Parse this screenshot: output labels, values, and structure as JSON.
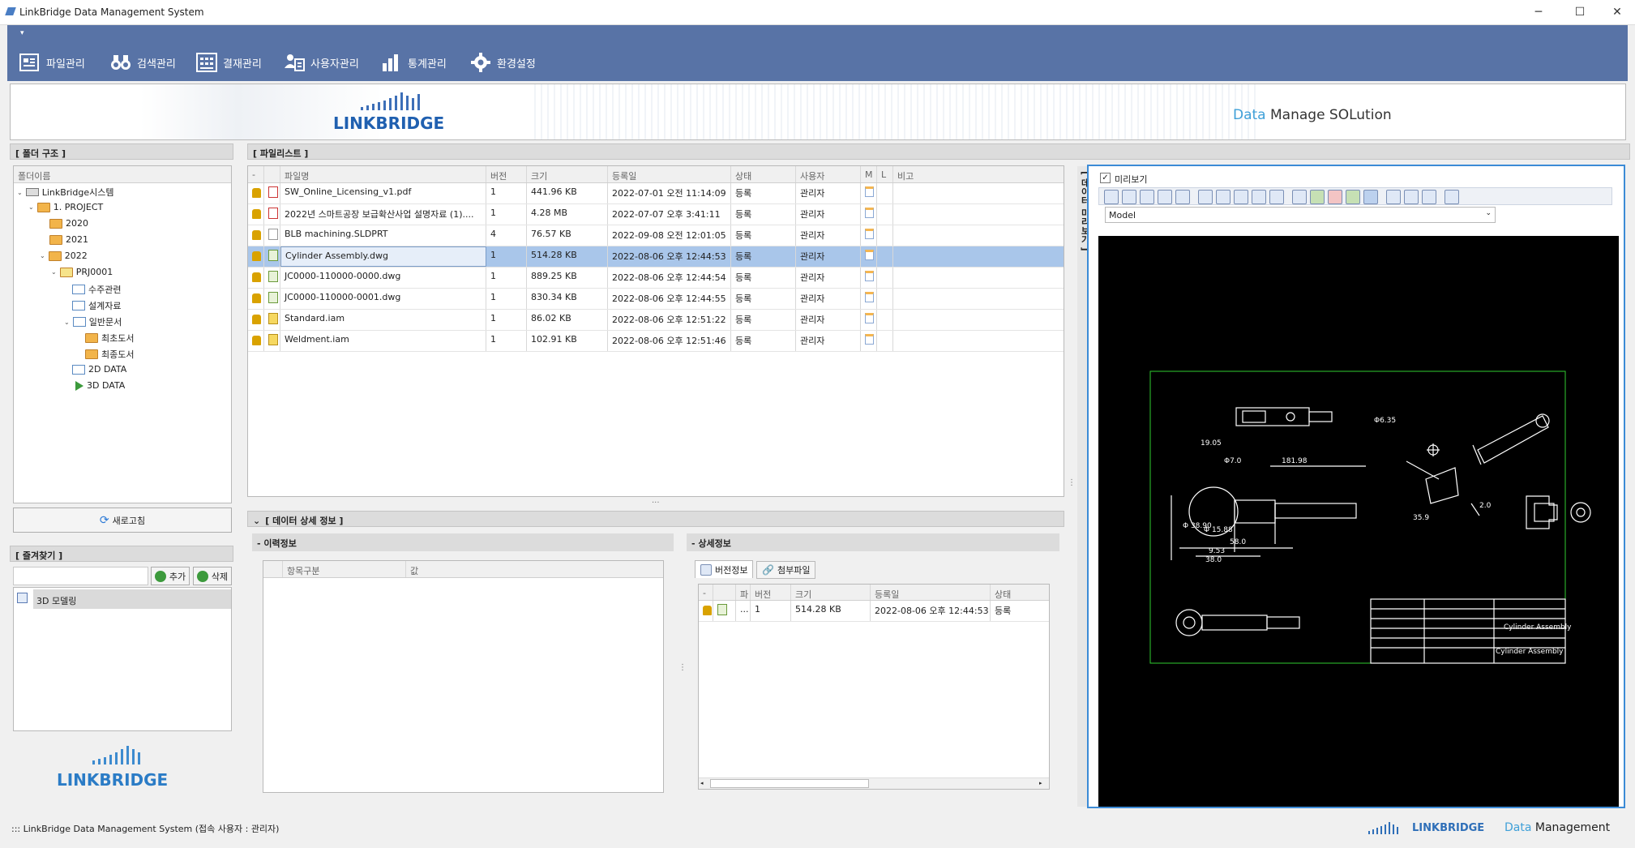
{
  "app": {
    "title": "LinkBridge Data Management System"
  },
  "window_controls": {
    "minimize": "─",
    "maximize": "☐",
    "close": "✕"
  },
  "toolbar": {
    "items": [
      {
        "label": "파일관리",
        "icon": "file-manage-icon"
      },
      {
        "label": "검색관리",
        "icon": "binoculars-icon"
      },
      {
        "label": "결재관리",
        "icon": "approval-icon"
      },
      {
        "label": "사용자관리",
        "icon": "user-manage-icon"
      },
      {
        "label": "통계관리",
        "icon": "bar-chart-icon"
      },
      {
        "label": "환경설정",
        "icon": "gear-icon"
      }
    ]
  },
  "banner": {
    "logo": "LINKBRIDGE",
    "slogan_accent": "Data",
    "slogan_rest": "Manage SOLution"
  },
  "folder_panel": {
    "title": "[ 폴더 구조 ]",
    "column": "폴더이름",
    "tree": [
      {
        "label": "LinkBridge시스템"
      },
      {
        "label": "1. PROJECT"
      },
      {
        "label": "2020"
      },
      {
        "label": "2021"
      },
      {
        "label": "2022"
      },
      {
        "label": "PRJ0001"
      },
      {
        "label": "수주관련"
      },
      {
        "label": "설계자료"
      },
      {
        "label": "일반문서"
      },
      {
        "label": "최초도서"
      },
      {
        "label": "최종도서"
      },
      {
        "label": "2D DATA"
      },
      {
        "label": "3D DATA"
      }
    ],
    "refresh_label": "새로고침"
  },
  "favorites_panel": {
    "title": "[ 즐겨찾기 ]",
    "add_label": "추가",
    "delete_label": "삭제",
    "items": [
      "3D 모델링"
    ]
  },
  "file_list": {
    "title": "[ 파일리스트 ]",
    "columns": [
      "-",
      "",
      "파일명",
      "버전",
      "크기",
      "등록일",
      "상태",
      "사용자",
      "M",
      "L",
      "비고"
    ],
    "rows": [
      {
        "name": "SW_Online_Licensing_v1.pdf",
        "ver": "1",
        "size": "441.96 KB",
        "date": "2022-07-01 오전 11:14:09",
        "status": "등록",
        "user": "관리자",
        "type": "pdf"
      },
      {
        "name": "2022년 스마트공장 보급확산사업 설명자료 (1)....",
        "ver": "1",
        "size": "4.28 MB",
        "date": "2022-07-07 오후 3:41:11",
        "status": "등록",
        "user": "관리자",
        "type": "pdf"
      },
      {
        "name": "BLB machining.SLDPRT",
        "ver": "4",
        "size": "76.57 KB",
        "date": "2022-09-08 오전 12:01:05",
        "status": "등록",
        "user": "관리자",
        "type": "blank"
      },
      {
        "name": "Cylinder Assembly.dwg",
        "ver": "1",
        "size": "514.28 KB",
        "date": "2022-08-06 오후 12:44:53",
        "status": "등록",
        "user": "관리자",
        "type": "dwg"
      },
      {
        "name": "JC0000-110000-0000.dwg",
        "ver": "1",
        "size": "889.25 KB",
        "date": "2022-08-06 오후 12:44:54",
        "status": "등록",
        "user": "관리자",
        "type": "dwg"
      },
      {
        "name": "JC0000-110000-0001.dwg",
        "ver": "1",
        "size": "830.34 KB",
        "date": "2022-08-06 오후 12:44:55",
        "status": "등록",
        "user": "관리자",
        "type": "dwg"
      },
      {
        "name": "Standard.iam",
        "ver": "1",
        "size": "86.02 KB",
        "date": "2022-08-06 오후 12:51:22",
        "status": "등록",
        "user": "관리자",
        "type": "iam"
      },
      {
        "name": "Weldment.iam",
        "ver": "1",
        "size": "102.91 KB",
        "date": "2022-08-06 오후 12:51:46",
        "status": "등록",
        "user": "관리자",
        "type": "iam"
      }
    ]
  },
  "detail": {
    "title": "[ 데이터 상세 정보 ]",
    "history_title": "- 이력정보",
    "history_columns": [
      "항목구분",
      "값"
    ],
    "detail_title": "- 상세정보",
    "tabs": [
      "버전정보",
      "첨부파일"
    ],
    "version_columns": [
      "-",
      "",
      "파",
      "버전",
      "크기",
      "등록일",
      "상태"
    ],
    "version_rows": [
      {
        "p": "...",
        "ver": "1",
        "size": "514.28 KB",
        "date": "2022-08-06 오후 12:44:53",
        "status": "등록"
      }
    ]
  },
  "preview": {
    "side_tab": "[ 데이터 미리보기 ]",
    "checkbox_label": "미리보기",
    "model_select": "Model",
    "dims": [
      "19.05",
      "Φ6.35",
      "Φ7.0",
      "181.98",
      "Φ 38.90",
      "Φ 15.88",
      "58.0",
      "9.53",
      "38.0",
      "35.9",
      "2.0",
      "Cylinder Assembly",
      "Cylinder Assembly"
    ]
  },
  "status": {
    "text": "::: LinkBridge Data Management System (접속 사용자 : 관리자)",
    "brand": "LINKBRIDGE",
    "accent": "Data",
    "rest": "Management"
  }
}
